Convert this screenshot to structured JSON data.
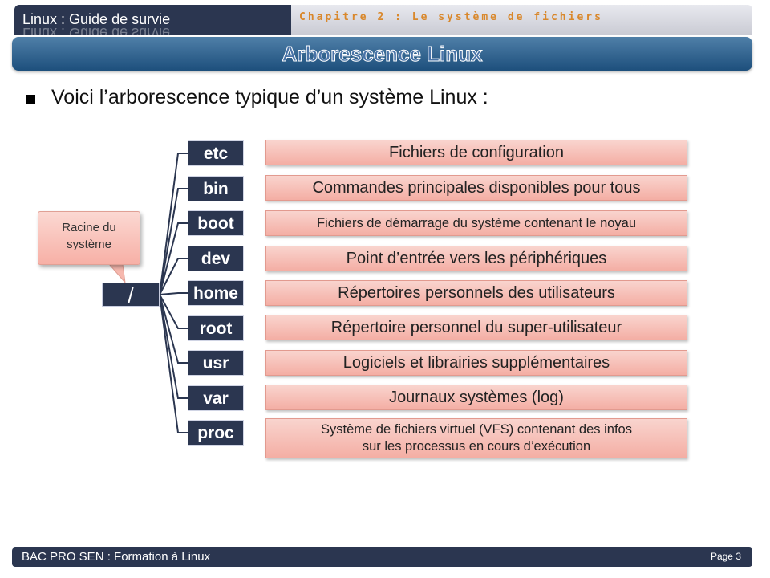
{
  "header": {
    "course_title": "Linux : Guide de survie",
    "chapter": "Chapitre 2 : Le système de fichiers"
  },
  "slide": {
    "title": "Arborescence Linux",
    "intro": "Voici l’arborescence typique d’un système Linux :"
  },
  "tree": {
    "root_label": "/",
    "callout": [
      "Racine du",
      "système"
    ],
    "directories": [
      {
        "name": "etc",
        "description": "Fichiers de configuration"
      },
      {
        "name": "bin",
        "description": "Commandes principales disponibles pour tous"
      },
      {
        "name": "boot",
        "description": "Fichiers de démarrage du système contenant le noyau"
      },
      {
        "name": "dev",
        "description": "Point d’entrée vers les périphériques"
      },
      {
        "name": "home",
        "description": "Répertoires personnels des utilisateurs"
      },
      {
        "name": "root",
        "description": "Répertoire personnel du super-utilisateur"
      },
      {
        "name": "usr",
        "description": "Logiciels et librairies supplémentaires"
      },
      {
        "name": "var",
        "description": "Journaux systèmes (log)"
      },
      {
        "name": "proc",
        "description": [
          "Système de fichiers virtuel (VFS) contenant des infos",
          "sur les processus en cours d’exécution"
        ]
      }
    ]
  },
  "footer": {
    "left": "BAC PRO SEN : Formation à Linux",
    "page": "Page 3"
  },
  "colors": {
    "dark_box": "#2b3650",
    "banner": "#1d4f7c",
    "pink_box": "#f4aea4",
    "chapter_orange": "#d9882c"
  }
}
